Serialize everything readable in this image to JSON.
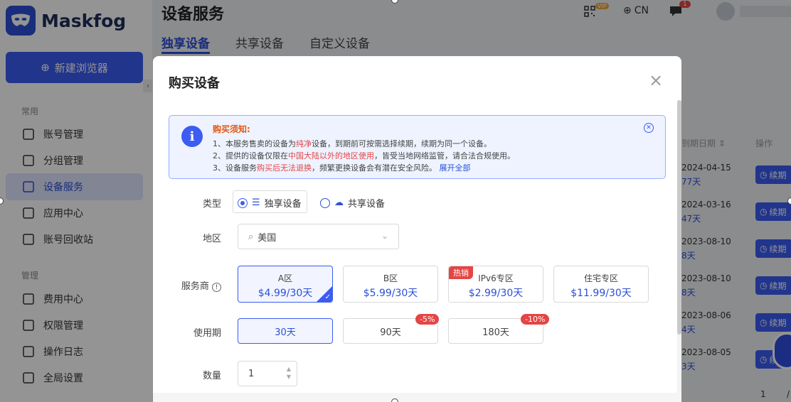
{
  "app": {
    "logo": "Maskfog",
    "new_browser": "新建浏览器",
    "section_common": "常用",
    "section_manage": "管理"
  },
  "nav_common": [
    {
      "label": "账号管理",
      "icon": "account-icon"
    },
    {
      "label": "分组管理",
      "icon": "folder-icon"
    },
    {
      "label": "设备服务",
      "icon": "location-icon",
      "active": true
    },
    {
      "label": "应用中心",
      "icon": "app-icon"
    },
    {
      "label": "账号回收站",
      "icon": "trash-icon"
    }
  ],
  "nav_manage": [
    {
      "label": "费用中心",
      "icon": "bill-icon"
    },
    {
      "label": "权限管理",
      "icon": "shield-icon"
    },
    {
      "label": "操作日志",
      "icon": "log-icon"
    },
    {
      "label": "全局设置",
      "icon": "settings-icon"
    }
  ],
  "header": {
    "title": "设备服务",
    "lang": "CN",
    "vip": "VIP",
    "msg_count": "1"
  },
  "tabs": [
    "独享设备",
    "共享设备",
    "自定义设备"
  ],
  "table_bg": {
    "col_date": "到期日期 ⇕",
    "col_action": "操作",
    "dates": [
      "2024-04-15",
      "2024-03-16",
      "2023-08-10",
      "2023-08-10",
      "2023-08-06",
      "2023-08-05"
    ],
    "days": [
      "77天",
      "47天",
      "8天",
      "8天",
      "4天",
      "3天"
    ],
    "renew": "续期",
    "page": "1",
    "slash": "/"
  },
  "modal": {
    "title": "购买设备",
    "notice": {
      "title": "购买须知:",
      "l1a": "1、本服务售卖的设备为",
      "l1b": "纯净",
      "l1c": "设备，到期前可按需选择续期，续期为同一个设备。",
      "l2a": "2、提供的设备仅限在",
      "l2b": "中国大陆以外的地区使用",
      "l2c": "，皆受当地网络监管，请合法合规使用。",
      "l3a": "3、设备服务",
      "l3b": "购买后无法退换",
      "l3c": "，频繁更换设备会有潜在安全风险。",
      "l3d": "展开全部"
    },
    "type_label": "类型",
    "type_exclusive": "独享设备",
    "type_shared": "共享设备",
    "region_label": "地区",
    "region_value": "美国",
    "provider_label": "服务商",
    "providers": [
      {
        "name": "A区",
        "price": "$4.99/30天",
        "selected": true
      },
      {
        "name": "B区",
        "price": "$5.99/30天"
      },
      {
        "name": "IPv6专区",
        "price": "$2.99/30天",
        "tag": "热销"
      },
      {
        "name": "住宅专区",
        "price": "$11.99/30天"
      }
    ],
    "period_label": "使用期",
    "periods": [
      {
        "label": "30天",
        "selected": true
      },
      {
        "label": "90天",
        "discount": "-5%"
      },
      {
        "label": "180天",
        "discount": "-10%"
      }
    ],
    "qty_label": "数量",
    "qty_value": "1"
  },
  "colors": {
    "accent": "#3c5cf2",
    "danger": "#e54545"
  }
}
